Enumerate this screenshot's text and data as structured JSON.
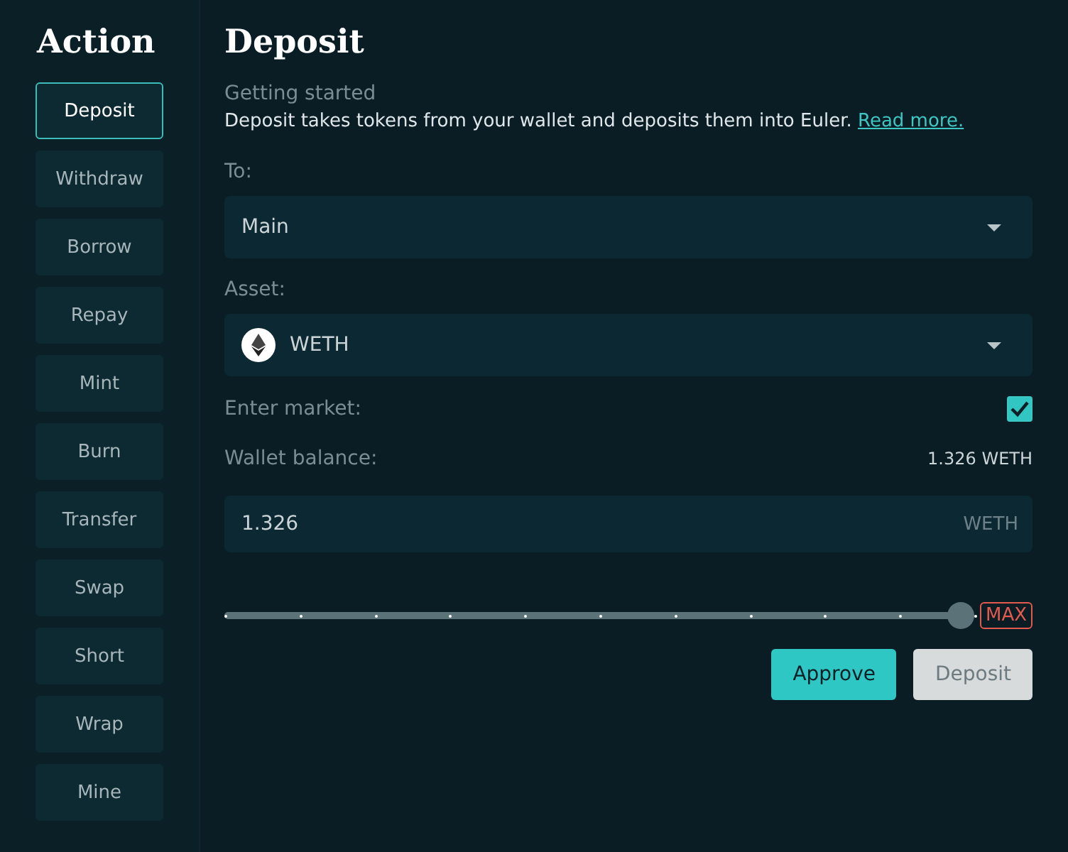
{
  "sidebar": {
    "title": "Action",
    "actions": [
      {
        "label": "Deposit",
        "selected": true
      },
      {
        "label": "Withdraw",
        "selected": false
      },
      {
        "label": "Borrow",
        "selected": false
      },
      {
        "label": "Repay",
        "selected": false
      },
      {
        "label": "Mint",
        "selected": false
      },
      {
        "label": "Burn",
        "selected": false
      },
      {
        "label": "Transfer",
        "selected": false
      },
      {
        "label": "Swap",
        "selected": false
      },
      {
        "label": "Short",
        "selected": false
      },
      {
        "label": "Wrap",
        "selected": false
      },
      {
        "label": "Mine",
        "selected": false
      }
    ]
  },
  "main": {
    "title": "Deposit",
    "intro_heading": "Getting started",
    "intro_text": "Deposit takes tokens from your wallet and deposits them into Euler.",
    "intro_link": "Read more.",
    "to": {
      "label": "To:",
      "value": "Main"
    },
    "asset": {
      "label": "Asset:",
      "value": "WETH"
    },
    "enter_market": {
      "label": "Enter market:",
      "checked": true
    },
    "wallet_balance": {
      "label": "Wallet balance:",
      "value": "1.326 WETH"
    },
    "amount": {
      "value": "1.326",
      "unit": "WETH"
    },
    "slider": {
      "level": 1.0
    },
    "max_button": "MAX",
    "buttons": [
      {
        "label": "Approve",
        "disabled": false
      },
      {
        "label": "Deposit",
        "disabled": true
      }
    ]
  }
}
